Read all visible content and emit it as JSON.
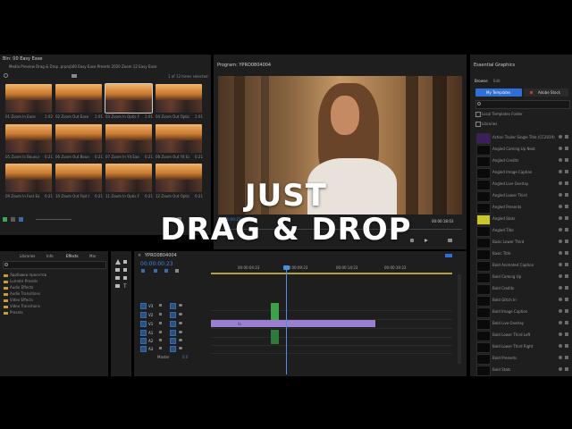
{
  "project": {
    "title": "Bin: 00 Easy Ease",
    "path": "Media Preview Drag & Drop .prproj\\00 Easy Ease Presets 2020 Zoom 12 Easy Ease",
    "items_count": "1 of 12 items selected",
    "clips": [
      {
        "name": "01 Zoom In Ease",
        "dur": "1:02"
      },
      {
        "name": "02 Zoom Out Ease",
        "dur": "1:01"
      },
      {
        "name": "03 Zoom In Optic F..",
        "dur": "1:01"
      },
      {
        "name": "04 Zoom Out Optic F..",
        "dur": "1:01"
      },
      {
        "name": "05 Zoom In Bounce..",
        "dur": "0:21"
      },
      {
        "name": "06 Zoom Out Bounc..",
        "dur": "0:21"
      },
      {
        "name": "07 Zoom In Yit Ease",
        "dur": "0:21"
      },
      {
        "name": "08 Zoom Out Yit Ease",
        "dur": "0:21"
      },
      {
        "name": "09 Zoom In Fast Ease",
        "dur": "0:21"
      },
      {
        "name": "10 Zoom Out Fast E..",
        "dur": "0:21"
      },
      {
        "name": "11 Zoom In Optic Fa..",
        "dur": "0:21"
      },
      {
        "name": "12 Zoom Out Optic..",
        "dur": "0:21"
      }
    ]
  },
  "program": {
    "title": "Program: YPRO0804004",
    "timecode_right": "00:00:18:03",
    "timecode_left": "00:00:00:23",
    "fit": "Full"
  },
  "overlay": {
    "line1": "JUST",
    "line2": "DRAG & DROP"
  },
  "effects_panel": {
    "tabs": [
      "Libraries",
      "Info",
      "Effects",
      "Mar"
    ],
    "items": [
      "Ядобавки пресетов",
      "Lumetri Presets",
      "Audio Effects",
      "Audio Transitions",
      "Video Effects",
      "Video Transitions",
      "Presets"
    ]
  },
  "timeline": {
    "sequence": "YPRO0804004",
    "timecode": "00:00:00:23",
    "ruler": [
      "00:00:04:23",
      "00:00:09:23",
      "00:00:14:23",
      "00:00:19:23"
    ],
    "tracks": [
      "V3",
      "V2",
      "V1",
      "A1",
      "A2",
      "A3"
    ],
    "master": "Master",
    "master_val": "0.0"
  },
  "essential_graphics": {
    "title": "Essential Graphics",
    "tabs": [
      "Browse",
      "Edit"
    ],
    "scope_btn": "My Templates",
    "stock_btn": "Adobe Stock",
    "local_label": "Local Templates Folder",
    "libraries_label": "Libraries",
    "templates": [
      "Action Trailer Single Title (CC2019)",
      "Angled Coming Up Next",
      "Angled Credits",
      "Angled Image Caption",
      "Angled Live Overlay",
      "Angled Lower Third",
      "Angled Presents",
      "Angled Stats",
      "Angled Title",
      "Basic Lower Third",
      "Basic Title",
      "Bold Animated Caption",
      "Bold Coming Up",
      "Bold Credits",
      "Bold Glitch In",
      "Bold Image Caption",
      "Bold Live Overlay",
      "Bold Lower Third Left",
      "Bold Lower Third Right",
      "Bold Presents",
      "Bold Stats"
    ]
  },
  "colors": {
    "accent_blue": "#2f6fd6",
    "clip_purple": "#9a7fd0",
    "clip_green": "#3fa04a",
    "playhead": "#4a90e2"
  }
}
